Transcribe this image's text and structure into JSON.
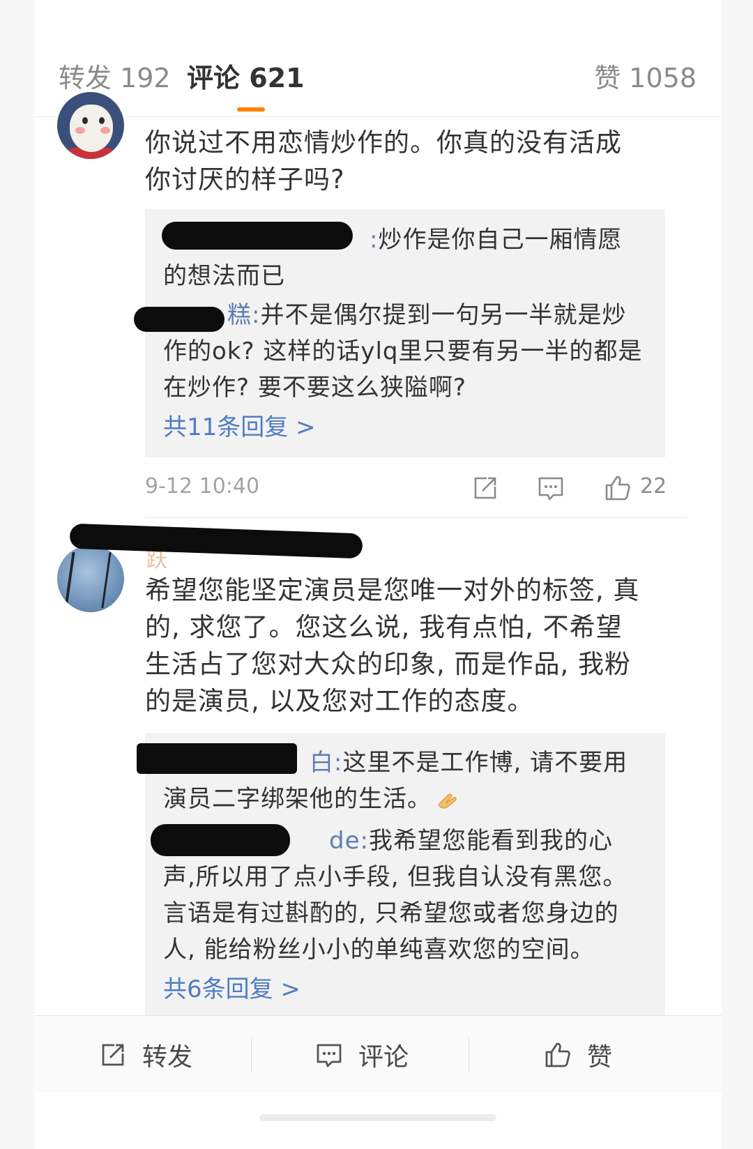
{
  "tabs": {
    "repost": "转发 192",
    "comments": "评论 621",
    "likes": "赞 1058"
  },
  "comments": [
    {
      "text": "你说过不用恋情炒作的。你真的没有活成你讨厌的样子吗?",
      "replies": [
        {
          "name_tail": ":",
          "text": "炒作是你自己一厢情愿的想法而已"
        },
        {
          "name_tail": "糕:",
          "text": "并不是偶尔提到一句另一半就是炒作的ok? 这样的话ylq里只要有另一半的都是在炒作? 要不要这么狭隘啊?"
        }
      ],
      "more_replies": "共11条回复 >",
      "time": "9-12 10:40",
      "like_count": "22"
    },
    {
      "text": "希望您能坚定演员是您唯一对外的标签, 真的, 求您了。您这么说, 我有点怕, 不希望生活占了您对大众的印象, 而是作品, 我粉的是演员, 以及您对工作的态度。",
      "replies": [
        {
          "name_tail": "白:",
          "text": "这里不是工作博, 请不要用演员二字绑架他的生活。"
        },
        {
          "name_tail": "de:",
          "text": "我希望您能看到我的心声,所以用了点小手段, 但我自认没有黑您。言语是有过斟酌的, 只希望您或者您身边的人, 能给粉丝小小的单纯喜欢您的空间。"
        }
      ],
      "more_replies": "共6条回复 >"
    }
  ],
  "bottom_bar": {
    "repost": "转发",
    "comment": "评论",
    "like": "赞"
  },
  "icons": [
    "share-icon",
    "comment-icon",
    "thumbs-up-icon",
    "clap-emoji-icon"
  ],
  "colors": {
    "accent": "#ff8200",
    "link": "#4f7cc2",
    "reply_name": "#5d7eb0",
    "reply_bg": "#f2f2f2"
  }
}
